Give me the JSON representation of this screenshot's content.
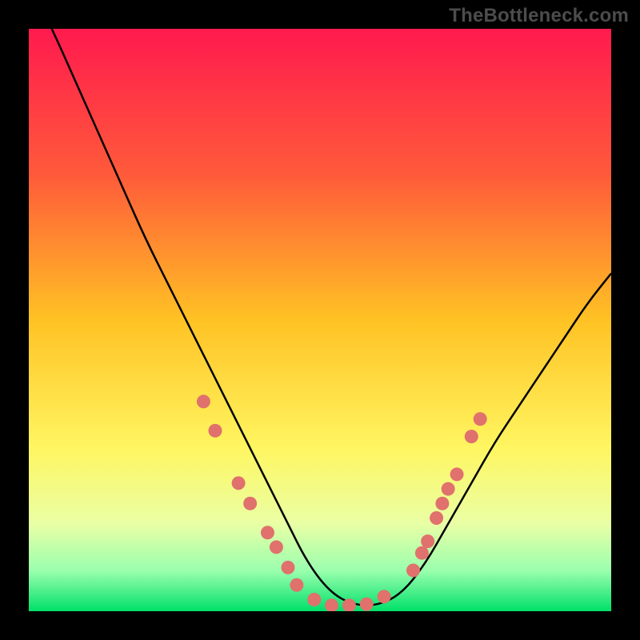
{
  "watermark": "TheBottleneck.com",
  "colors": {
    "frame": "#000000",
    "watermark_text": "#4c4c4c",
    "curve": "#000000",
    "marker_fill": "#e0716d",
    "gradient_stops": [
      {
        "offset": 0.0,
        "color": "#ff1a4e"
      },
      {
        "offset": 0.25,
        "color": "#ff5a3a"
      },
      {
        "offset": 0.5,
        "color": "#ffc224"
      },
      {
        "offset": 0.72,
        "color": "#fff661"
      },
      {
        "offset": 0.85,
        "color": "#e9ffa5"
      },
      {
        "offset": 0.93,
        "color": "#9bffae"
      },
      {
        "offset": 1.0,
        "color": "#00e06a"
      }
    ]
  },
  "chart_data": {
    "type": "line",
    "title": "",
    "xlabel": "",
    "ylabel": "",
    "xlim": [
      0,
      100
    ],
    "ylim": [
      0,
      100
    ],
    "grid": false,
    "legend": false,
    "series": [
      {
        "name": "bottleneck-curve",
        "x": [
          0,
          4,
          8,
          12,
          16,
          20,
          24,
          28,
          32,
          36,
          40,
          44,
          48,
          52,
          56,
          60,
          64,
          68,
          72,
          76,
          80,
          84,
          88,
          92,
          96,
          100
        ],
        "y": [
          108,
          100,
          91,
          82,
          73,
          64,
          56,
          48,
          40,
          32,
          24,
          16,
          8,
          3,
          1,
          1,
          3,
          8,
          15,
          22,
          29,
          35,
          41,
          47,
          53,
          58
        ]
      }
    ],
    "markers": [
      {
        "x": 30.0,
        "y": 36.0
      },
      {
        "x": 32.0,
        "y": 31.0
      },
      {
        "x": 36.0,
        "y": 22.0
      },
      {
        "x": 38.0,
        "y": 18.5
      },
      {
        "x": 41.0,
        "y": 13.5
      },
      {
        "x": 42.5,
        "y": 11.0
      },
      {
        "x": 44.5,
        "y": 7.5
      },
      {
        "x": 46.0,
        "y": 4.5
      },
      {
        "x": 49.0,
        "y": 2.0
      },
      {
        "x": 52.0,
        "y": 1.0
      },
      {
        "x": 55.0,
        "y": 1.0
      },
      {
        "x": 58.0,
        "y": 1.2
      },
      {
        "x": 61.0,
        "y": 2.5
      },
      {
        "x": 66.0,
        "y": 7.0
      },
      {
        "x": 67.5,
        "y": 10.0
      },
      {
        "x": 68.5,
        "y": 12.0
      },
      {
        "x": 70.0,
        "y": 16.0
      },
      {
        "x": 71.0,
        "y": 18.5
      },
      {
        "x": 72.0,
        "y": 21.0
      },
      {
        "x": 73.5,
        "y": 23.5
      },
      {
        "x": 76.0,
        "y": 30.0
      },
      {
        "x": 77.5,
        "y": 33.0
      }
    ]
  }
}
